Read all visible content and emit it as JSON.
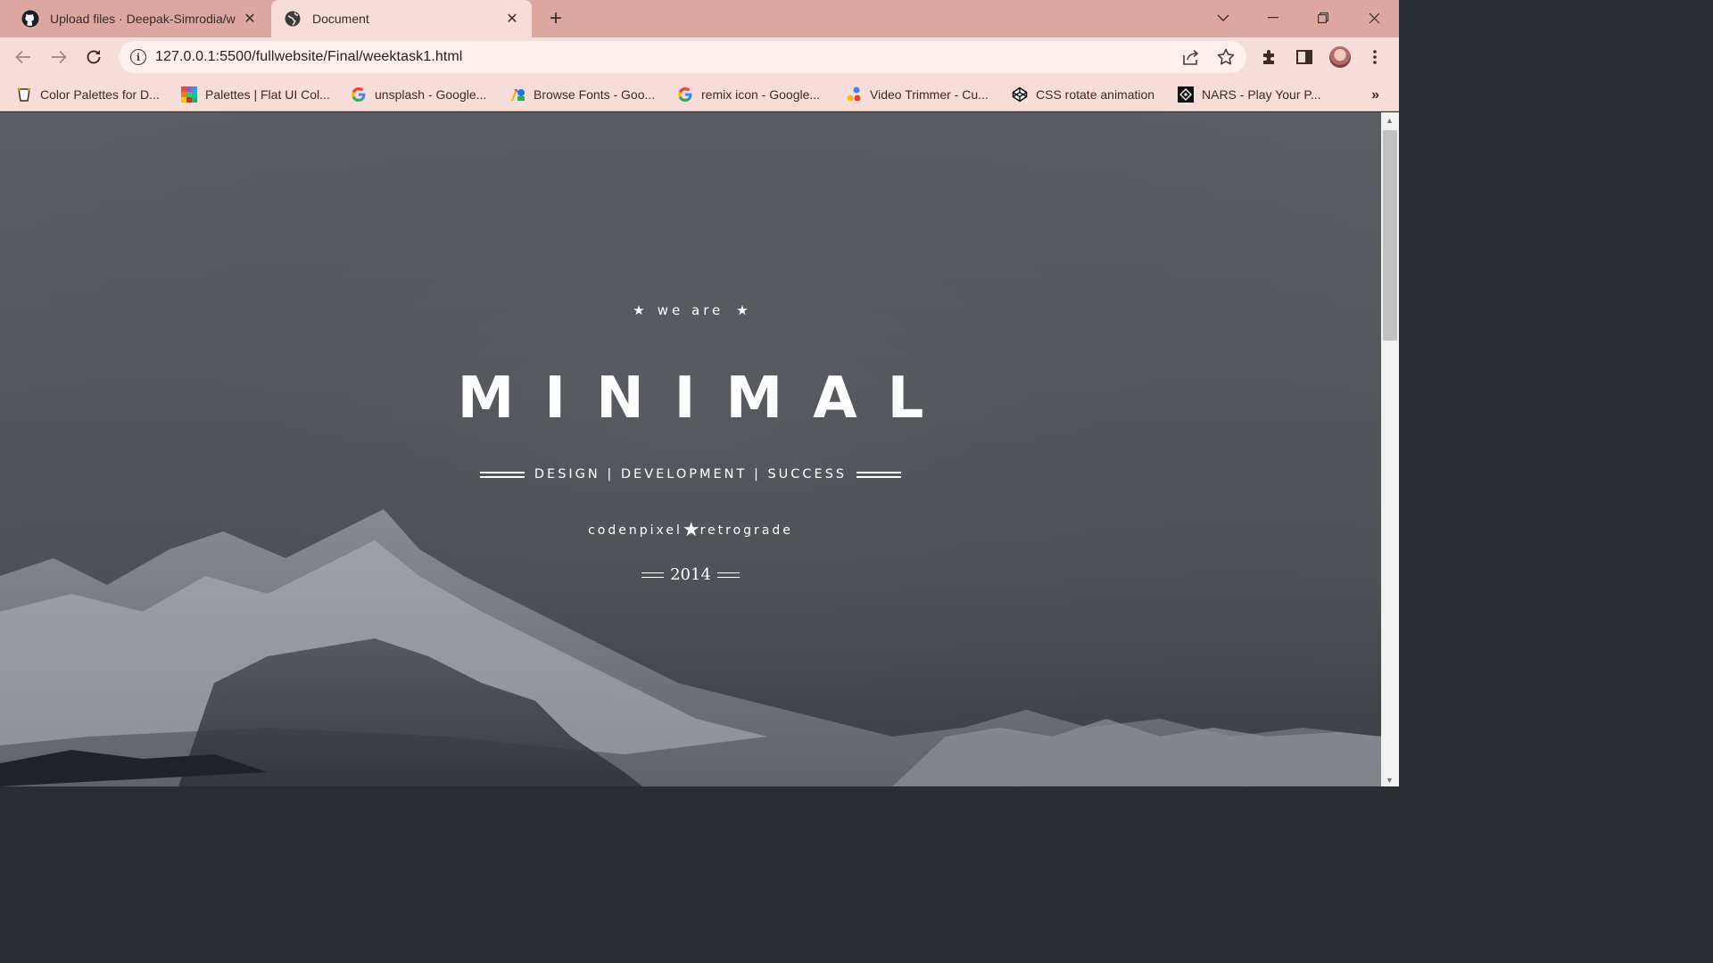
{
  "browser": {
    "tabs": [
      {
        "title": "Upload files · Deepak-Simrodia/w",
        "icon": "github-icon",
        "active": false
      },
      {
        "title": "Document",
        "icon": "globe-icon",
        "active": true
      }
    ],
    "new_tab_label": "+",
    "url": "127.0.0.1:5500/fullwebsite/Final/weektask1.html",
    "bookmarks": [
      {
        "label": "Color Palettes for D...",
        "icon": "palette-cup-icon",
        "color": "#c0392b"
      },
      {
        "label": "Palettes | Flat UI Col...",
        "icon": "flatui-icon",
        "color": "#e67e22"
      },
      {
        "label": "unsplash - Google...",
        "icon": "google-icon",
        "color": "#4285f4"
      },
      {
        "label": "Browse Fonts - Goo...",
        "icon": "google-fonts-icon",
        "color": "#34a853"
      },
      {
        "label": "remix icon - Google...",
        "icon": "google-icon",
        "color": "#4285f4"
      },
      {
        "label": "Video Trimmer - Cu...",
        "icon": "video-trimmer-icon",
        "color": "#fbbc05"
      },
      {
        "label": "CSS rotate animation",
        "icon": "codepen-icon",
        "color": "#000000"
      },
      {
        "label": "NARS - Play Your P...",
        "icon": "nars-icon",
        "color": "#111111"
      }
    ]
  },
  "hero": {
    "eyebrow": "we are",
    "title": "MINIMAL",
    "tagline": "DESIGN | DEVELOPMENT | SUCCESS",
    "credit_left": "codenpixel",
    "credit_right": "retrograde",
    "year": "2014"
  }
}
